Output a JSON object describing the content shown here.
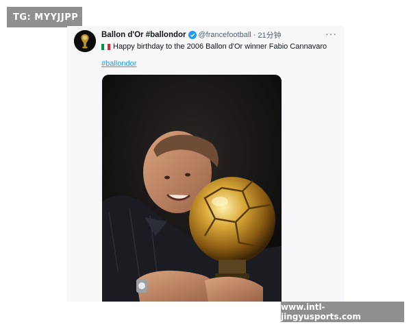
{
  "watermark": {
    "top_left": "TG: MYYJJPP",
    "bottom_right": "www.intl-jingyusports.com"
  },
  "tweet": {
    "display_name": "Ballon d'Or #ballondor",
    "handle": "@francefootball",
    "separator": "·",
    "time": "21分钟",
    "more_label": "···",
    "flag_colors": [
      "#009246",
      "#ffffff",
      "#ce2b37"
    ],
    "text": "Happy birthday to the 2006 Ballon d'Or winner Fabio Cannavaro",
    "hashtag": "#ballondor"
  },
  "colors": {
    "verified": "#1d9bf0",
    "link": "#1d9bf0",
    "watermark_bg": "#8f8f8f"
  },
  "icons": {
    "avatar": "golden-ball-trophy-icon",
    "verified": "verified-badge-icon",
    "more": "more-horizontal-icon"
  }
}
